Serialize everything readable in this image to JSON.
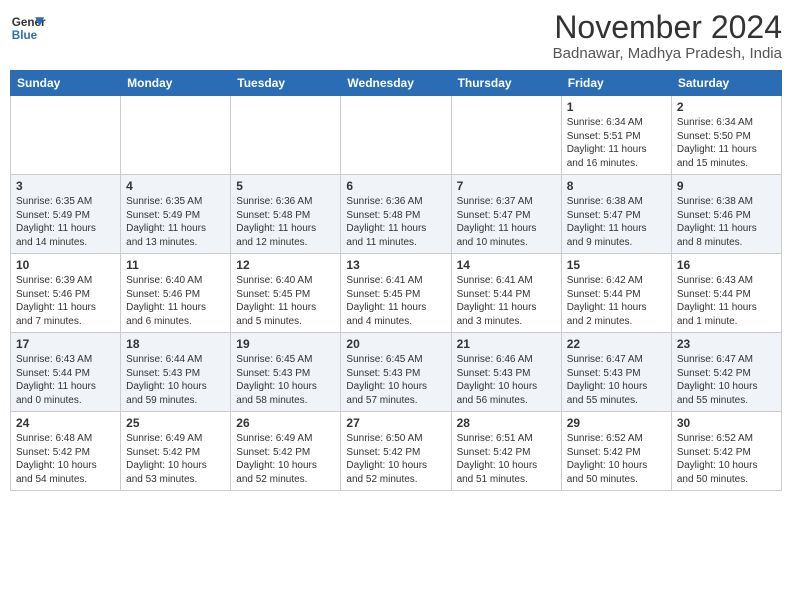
{
  "header": {
    "logo_line1": "General",
    "logo_line2": "Blue",
    "month_title": "November 2024",
    "location": "Badnawar, Madhya Pradesh, India"
  },
  "days_of_week": [
    "Sunday",
    "Monday",
    "Tuesday",
    "Wednesday",
    "Thursday",
    "Friday",
    "Saturday"
  ],
  "weeks": [
    [
      {
        "day": "",
        "content": ""
      },
      {
        "day": "",
        "content": ""
      },
      {
        "day": "",
        "content": ""
      },
      {
        "day": "",
        "content": ""
      },
      {
        "day": "",
        "content": ""
      },
      {
        "day": "1",
        "content": "Sunrise: 6:34 AM\nSunset: 5:51 PM\nDaylight: 11 hours and 16 minutes."
      },
      {
        "day": "2",
        "content": "Sunrise: 6:34 AM\nSunset: 5:50 PM\nDaylight: 11 hours and 15 minutes."
      }
    ],
    [
      {
        "day": "3",
        "content": "Sunrise: 6:35 AM\nSunset: 5:49 PM\nDaylight: 11 hours and 14 minutes."
      },
      {
        "day": "4",
        "content": "Sunrise: 6:35 AM\nSunset: 5:49 PM\nDaylight: 11 hours and 13 minutes."
      },
      {
        "day": "5",
        "content": "Sunrise: 6:36 AM\nSunset: 5:48 PM\nDaylight: 11 hours and 12 minutes."
      },
      {
        "day": "6",
        "content": "Sunrise: 6:36 AM\nSunset: 5:48 PM\nDaylight: 11 hours and 11 minutes."
      },
      {
        "day": "7",
        "content": "Sunrise: 6:37 AM\nSunset: 5:47 PM\nDaylight: 11 hours and 10 minutes."
      },
      {
        "day": "8",
        "content": "Sunrise: 6:38 AM\nSunset: 5:47 PM\nDaylight: 11 hours and 9 minutes."
      },
      {
        "day": "9",
        "content": "Sunrise: 6:38 AM\nSunset: 5:46 PM\nDaylight: 11 hours and 8 minutes."
      }
    ],
    [
      {
        "day": "10",
        "content": "Sunrise: 6:39 AM\nSunset: 5:46 PM\nDaylight: 11 hours and 7 minutes."
      },
      {
        "day": "11",
        "content": "Sunrise: 6:40 AM\nSunset: 5:46 PM\nDaylight: 11 hours and 6 minutes."
      },
      {
        "day": "12",
        "content": "Sunrise: 6:40 AM\nSunset: 5:45 PM\nDaylight: 11 hours and 5 minutes."
      },
      {
        "day": "13",
        "content": "Sunrise: 6:41 AM\nSunset: 5:45 PM\nDaylight: 11 hours and 4 minutes."
      },
      {
        "day": "14",
        "content": "Sunrise: 6:41 AM\nSunset: 5:44 PM\nDaylight: 11 hours and 3 minutes."
      },
      {
        "day": "15",
        "content": "Sunrise: 6:42 AM\nSunset: 5:44 PM\nDaylight: 11 hours and 2 minutes."
      },
      {
        "day": "16",
        "content": "Sunrise: 6:43 AM\nSunset: 5:44 PM\nDaylight: 11 hours and 1 minute."
      }
    ],
    [
      {
        "day": "17",
        "content": "Sunrise: 6:43 AM\nSunset: 5:44 PM\nDaylight: 11 hours and 0 minutes."
      },
      {
        "day": "18",
        "content": "Sunrise: 6:44 AM\nSunset: 5:43 PM\nDaylight: 10 hours and 59 minutes."
      },
      {
        "day": "19",
        "content": "Sunrise: 6:45 AM\nSunset: 5:43 PM\nDaylight: 10 hours and 58 minutes."
      },
      {
        "day": "20",
        "content": "Sunrise: 6:45 AM\nSunset: 5:43 PM\nDaylight: 10 hours and 57 minutes."
      },
      {
        "day": "21",
        "content": "Sunrise: 6:46 AM\nSunset: 5:43 PM\nDaylight: 10 hours and 56 minutes."
      },
      {
        "day": "22",
        "content": "Sunrise: 6:47 AM\nSunset: 5:43 PM\nDaylight: 10 hours and 55 minutes."
      },
      {
        "day": "23",
        "content": "Sunrise: 6:47 AM\nSunset: 5:42 PM\nDaylight: 10 hours and 55 minutes."
      }
    ],
    [
      {
        "day": "24",
        "content": "Sunrise: 6:48 AM\nSunset: 5:42 PM\nDaylight: 10 hours and 54 minutes."
      },
      {
        "day": "25",
        "content": "Sunrise: 6:49 AM\nSunset: 5:42 PM\nDaylight: 10 hours and 53 minutes."
      },
      {
        "day": "26",
        "content": "Sunrise: 6:49 AM\nSunset: 5:42 PM\nDaylight: 10 hours and 52 minutes."
      },
      {
        "day": "27",
        "content": "Sunrise: 6:50 AM\nSunset: 5:42 PM\nDaylight: 10 hours and 52 minutes."
      },
      {
        "day": "28",
        "content": "Sunrise: 6:51 AM\nSunset: 5:42 PM\nDaylight: 10 hours and 51 minutes."
      },
      {
        "day": "29",
        "content": "Sunrise: 6:52 AM\nSunset: 5:42 PM\nDaylight: 10 hours and 50 minutes."
      },
      {
        "day": "30",
        "content": "Sunrise: 6:52 AM\nSunset: 5:42 PM\nDaylight: 10 hours and 50 minutes."
      }
    ]
  ]
}
